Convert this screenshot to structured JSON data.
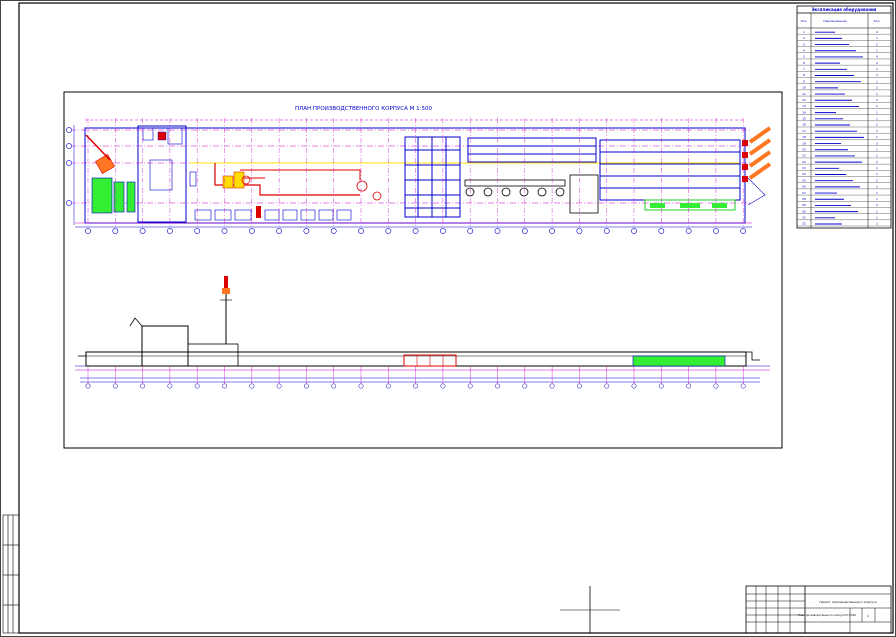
{
  "plan": {
    "title": "ПЛАН ПРОИЗВОДСТВЕННОГО КОРПУСА М 1:500"
  },
  "spec": {
    "title": "Экспликация оборудования",
    "header_num": "Поз.",
    "header_name": "Наименование",
    "header_qty": "Кол.",
    "rows": [
      {
        "n": "1",
        "q": "4"
      },
      {
        "n": "2",
        "q": "1"
      },
      {
        "n": "3",
        "q": "2"
      },
      {
        "n": "4",
        "q": "1"
      },
      {
        "n": "5",
        "q": "4"
      },
      {
        "n": "6",
        "q": "2"
      },
      {
        "n": "7",
        "q": "1"
      },
      {
        "n": "8",
        "q": "3"
      },
      {
        "n": "9",
        "q": "1"
      },
      {
        "n": "10",
        "q": "2"
      },
      {
        "n": "11",
        "q": "1"
      },
      {
        "n": "12",
        "q": "1"
      },
      {
        "n": "13",
        "q": "2"
      },
      {
        "n": "14",
        "q": "1"
      },
      {
        "n": "15",
        "q": "1"
      },
      {
        "n": "16",
        "q": "2"
      },
      {
        "n": "17",
        "q": "1"
      },
      {
        "n": "18",
        "q": "1"
      },
      {
        "n": "19",
        "q": "3"
      },
      {
        "n": "20",
        "q": "1"
      },
      {
        "n": "21",
        "q": "1"
      },
      {
        "n": "22",
        "q": "2"
      },
      {
        "n": "23",
        "q": "1"
      },
      {
        "n": "24",
        "q": "1"
      },
      {
        "n": "25",
        "q": "2"
      },
      {
        "n": "26",
        "q": "1"
      },
      {
        "n": "27",
        "q": "1"
      },
      {
        "n": "28",
        "q": "1"
      },
      {
        "n": "29",
        "q": "2"
      },
      {
        "n": "30",
        "q": "1"
      },
      {
        "n": "31",
        "q": "1"
      },
      {
        "n": "32",
        "q": "1"
      }
    ]
  },
  "titleblock": {
    "project": "Проект производственного корпуса",
    "sheet_label": "План производственного корпуса М 1:500",
    "sheet_no": "1"
  },
  "colors": {
    "line": "#0000cc",
    "axis": "#cc00cc",
    "accent_red": "#dd0000",
    "accent_green": "#33ee33",
    "accent_yellow": "#ffdd00",
    "accent_orange": "#ff7722"
  }
}
